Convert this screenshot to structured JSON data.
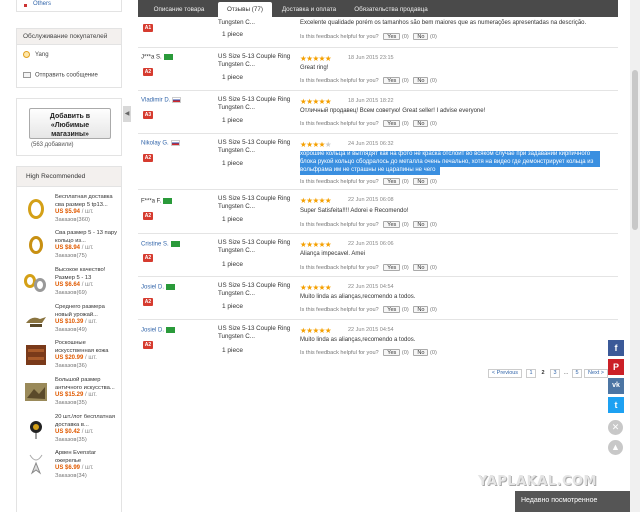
{
  "sidebar": {
    "others_link": "Others",
    "customer_service": {
      "title": "Обслуживание покупателей",
      "agent": "Yang",
      "send_message": "Отправить сообщение"
    },
    "favorites": {
      "button_line1": "Добавить в",
      "button_line2": "«Любимые",
      "button_line3": "магазины»",
      "count": "(563 добавили)"
    },
    "high_recommended": {
      "title": "High Recommended",
      "items": [
        {
          "name": "Бесплатная доставка сва размер 5 tp13...",
          "price": "US $5.94",
          "unit": "/ шт.",
          "orders": "Заказов(360)"
        },
        {
          "name": "Сва размер 5 - 13 пару кольцо из...",
          "price": "US $8.94",
          "unit": "/ шт.",
          "orders": "Заказов(75)"
        },
        {
          "name": "Высокое качество! Размер 5 - 13",
          "price": "US $6.64",
          "unit": "/ шт.",
          "orders": "Заказов(69)"
        },
        {
          "name": "Среднего размера новый урожай...",
          "price": "US $10.39",
          "unit": "/ шт.",
          "orders": "Заказов(49)"
        },
        {
          "name": "Роскошные искусственная кожа",
          "price": "US $20.99",
          "unit": "/ шт.",
          "orders": "Заказов(36)"
        },
        {
          "name": "Большой размер античного искусства...",
          "price": "US $15.29",
          "unit": "/ шт.",
          "orders": "Заказов(35)"
        },
        {
          "name": "20 шт./лот бесплатная доставка в...",
          "price": "US $0.42",
          "unit": "/ шт.",
          "orders": "Заказов(35)"
        },
        {
          "name": "Арвен Evenstar ожерелье",
          "price": "US $6.99",
          "unit": "/ шт.",
          "orders": "Заказов(34)"
        }
      ]
    }
  },
  "tabs": [
    {
      "label": "Описание товара"
    },
    {
      "label": "Отзывы (77)"
    },
    {
      "label": "Доставка и оплата"
    },
    {
      "label": "Обязательства продавца"
    }
  ],
  "helpful_prompt": "Is this feedback helpful for you?",
  "yes_label": "Yes",
  "no_label": "No",
  "reviews": [
    {
      "name": "",
      "badge": "A1",
      "product1": "",
      "product2": "Tungsten C...",
      "qty": "1 piece",
      "date": "",
      "text": "Excelente qualidade porém os tamanhos são bem maiores que as numerações apresentadas na descrição.",
      "yes": "(0)",
      "no": "(0)"
    },
    {
      "name": "J***a S.",
      "badge": "A2",
      "product1": "US Size 5-13 Couple Ring",
      "product2": "Tungsten C...",
      "qty": "1 piece",
      "date": "18 Jun 2015 23:15",
      "text": "Great ring!",
      "yes": "(0)",
      "no": "(0)"
    },
    {
      "name": "Vladimir D.",
      "badge": "A3",
      "product1": "US Size 5-13 Couple Ring",
      "product2": "Tungsten C...",
      "qty": "1 piece",
      "date": "18 Jun 2015 18:22",
      "text": "Отличный продавец! Всем советую! Great seller! I advise everyone!",
      "yes": "(0)",
      "no": "(0)"
    },
    {
      "name": "Nikolay G.",
      "badge": "A2",
      "product1": "US Size 5-13 Couple Ring",
      "product2": "Tungsten C...",
      "qty": "1 piece",
      "date": "24 Jun 2015 06:32",
      "text1": "хорошие кольца и выглядят как на фото не краска отслоит во всяком случае при задавании кирпичного",
      "text2": "блока рукой кольцо сбодралось до металла очень печально, хотя на видео где демонстрирует кольца из",
      "text3": "вольфрама им не страшны не царапины не чего",
      "yes": "(0)",
      "no": "(0)"
    },
    {
      "name": "F***a F.",
      "badge": "A2",
      "product1": "US Size 5-13 Couple Ring",
      "product2": "Tungsten C...",
      "qty": "1 piece",
      "date": "22 Jun 2015 06:08",
      "text": "Super Satisfeita!!!! Adorei e Recomendo!",
      "yes": "(0)",
      "no": "(0)"
    },
    {
      "name": "Cristine S.",
      "badge": "A2",
      "product1": "US Size 5-13 Couple Ring",
      "product2": "Tungsten C...",
      "qty": "1 piece",
      "date": "22 Jun 2015 06:06",
      "text": "Aliança impecavel. Amei",
      "yes": "(0)",
      "no": "(0)"
    },
    {
      "name": "Josiel D.",
      "badge": "A2",
      "product1": "US Size 5-13 Couple Ring",
      "product2": "Tungsten C...",
      "qty": "1 piece",
      "date": "22 Jun 2015 04:54",
      "text": "Muito linda as alianças,recomendo a todos.",
      "yes": "(0)",
      "no": "(0)"
    },
    {
      "name": "Josiel D.",
      "badge": "A2",
      "product1": "US Size 5-13 Couple Ring",
      "product2": "Tungsten C...",
      "qty": "1 piece",
      "date": "22 Jun 2015 04:54",
      "text": "Muito linda as alianças,recomendo a todos.",
      "yes": "(0)",
      "no": "(0)"
    }
  ],
  "pager": {
    "prev": "< Previous",
    "p1": "1",
    "p2": "2",
    "p3": "3",
    "dots": "...",
    "p5": "5",
    "next": "Next >"
  },
  "watermark": "YAPLAKAL.COM",
  "recently_viewed": "Недавно посмотренное",
  "colors": {
    "accent_red": "#d63b2f",
    "star": "#f5a000",
    "link": "#3366aa",
    "highlight": "#3a8fe0",
    "tab_bar": "#4a4a4a"
  }
}
